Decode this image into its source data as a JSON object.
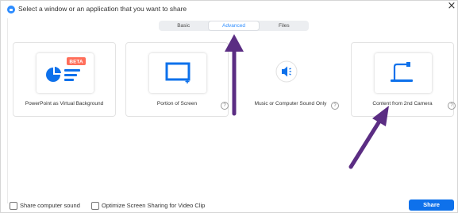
{
  "window": {
    "title": "Select a window or an application that you want to share"
  },
  "tabs": [
    {
      "label": "Basic",
      "active": false
    },
    {
      "label": "Advanced",
      "active": true
    },
    {
      "label": "Files",
      "active": false
    }
  ],
  "cards": [
    {
      "label": "PowerPoint as Virtual Background",
      "icon": "powerpoint-virtual-background-icon",
      "badge": "BETA",
      "has_help": false
    },
    {
      "label": "Portion of Screen",
      "icon": "screen-portion-icon",
      "has_help": true
    },
    {
      "label": "Music or Computer Sound Only",
      "icon": "speaker-icon",
      "has_help": true
    },
    {
      "label": "Content from 2nd Camera",
      "icon": "document-camera-icon",
      "has_help": true
    }
  ],
  "footer": {
    "share_sound_label": "Share computer sound",
    "share_sound_checked": false,
    "optimize_label": "Optimize Screen Sharing for Video Clip",
    "optimize_checked": false,
    "share_button_label": "Share"
  },
  "colors": {
    "accent": "#2d8cff",
    "share_button": "#0e71eb",
    "badge": "#ff6e5a",
    "annotation_arrow": "#5b2d83"
  }
}
